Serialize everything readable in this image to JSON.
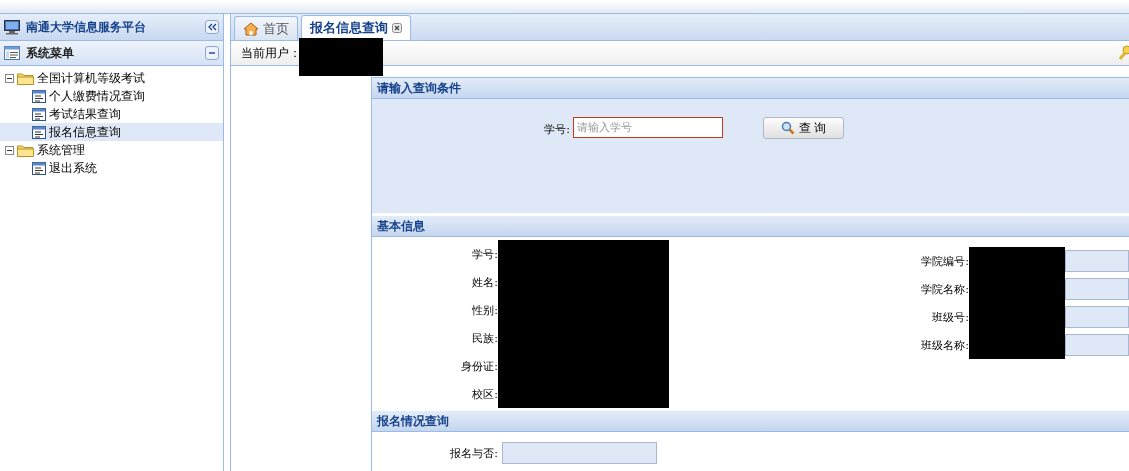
{
  "sidebar": {
    "title": "南通大学信息服务平台",
    "menu_title": "系统菜单",
    "tree": [
      {
        "label": "全国计算机等级考试",
        "expanded": true,
        "children": [
          {
            "label": "个人缴费情况查询",
            "selected": false
          },
          {
            "label": "考试结果查询",
            "selected": false
          },
          {
            "label": "报名信息查询",
            "selected": true
          }
        ]
      },
      {
        "label": "系统管理",
        "expanded": true,
        "children": [
          {
            "label": "退出系统",
            "selected": false
          }
        ]
      }
    ]
  },
  "tabs": [
    {
      "label": "首页",
      "kind": "home",
      "selected": false
    },
    {
      "label": "报名信息查询",
      "kind": "closable",
      "selected": true
    }
  ],
  "toolbar": {
    "user_label": "当前用户：",
    "user_redacted": true
  },
  "query_section": {
    "title": "请输入查询条件",
    "field_label": "学号:",
    "placeholder": "请输入学号",
    "button": "查 询"
  },
  "basic_section": {
    "title": "基本信息",
    "left_fields": [
      {
        "label": "学号:",
        "redacted": true
      },
      {
        "label": "姓名:",
        "redacted": true
      },
      {
        "label": "性别:",
        "redacted": true
      },
      {
        "label": "民族:",
        "redacted": true
      },
      {
        "label": "身份证:",
        "redacted": true
      },
      {
        "label": "校区:",
        "redacted": true
      }
    ],
    "right_fields": [
      {
        "label": "学院编号:",
        "redacted": true
      },
      {
        "label": "学院名称:",
        "redacted": true
      },
      {
        "label": "班级号:",
        "redacted": true
      },
      {
        "label": "班级名称:",
        "redacted": true
      }
    ]
  },
  "registration_section": {
    "title": "报名情况查询",
    "field_label": "报名与否:"
  }
}
